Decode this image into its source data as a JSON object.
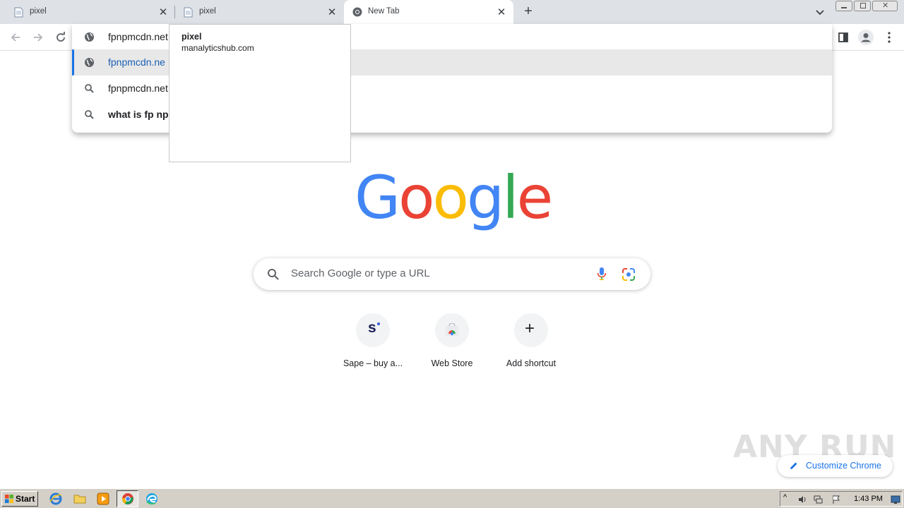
{
  "tabs": [
    {
      "title": "pixel",
      "active": false
    },
    {
      "title": "pixel",
      "active": false
    },
    {
      "title": "New Tab",
      "active": true
    }
  ],
  "omnibox": {
    "suggestions": [
      {
        "text": "fpnpmcdn.net",
        "icon": "globe-icon",
        "selected": false,
        "bold": false
      },
      {
        "text": "fpnpmcdn.ne",
        "icon": "globe-icon",
        "selected": true,
        "bold": false
      },
      {
        "text": "fpnpmcdn.net",
        "icon": "search-icon",
        "selected": false,
        "bold": false
      },
      {
        "text": "what is fp np",
        "icon": "search-icon",
        "selected": false,
        "bold": true
      }
    ]
  },
  "tooltip": {
    "title": "pixel",
    "url": "manalyticshub.com"
  },
  "ntp": {
    "logo_letters": [
      {
        "ch": "G",
        "color": "#4285f4"
      },
      {
        "ch": "o",
        "color": "#ea4335"
      },
      {
        "ch": "o",
        "color": "#fbbc05"
      },
      {
        "ch": "g",
        "color": "#4285f4"
      },
      {
        "ch": "l",
        "color": "#34a853"
      },
      {
        "ch": "e",
        "color": "#ea4335"
      }
    ],
    "search_placeholder": "Search Google or type a URL",
    "shortcuts": [
      {
        "label": "Sape – buy a...",
        "icon": "sape-icon",
        "glyph": "s"
      },
      {
        "label": "Web Store",
        "icon": "webstore-icon",
        "glyph": ""
      },
      {
        "label": "Add shortcut",
        "icon": "plus-icon",
        "glyph": "+"
      }
    ],
    "customize_label": "Customize Chrome"
  },
  "watermark": "ANY RUN",
  "taskbar": {
    "start_label": "Start",
    "clock": "1:43 PM"
  },
  "colors": {
    "accent": "#1a73e8",
    "tabstrip": "#dee1e6",
    "taskbar": "#d4d0c8"
  }
}
